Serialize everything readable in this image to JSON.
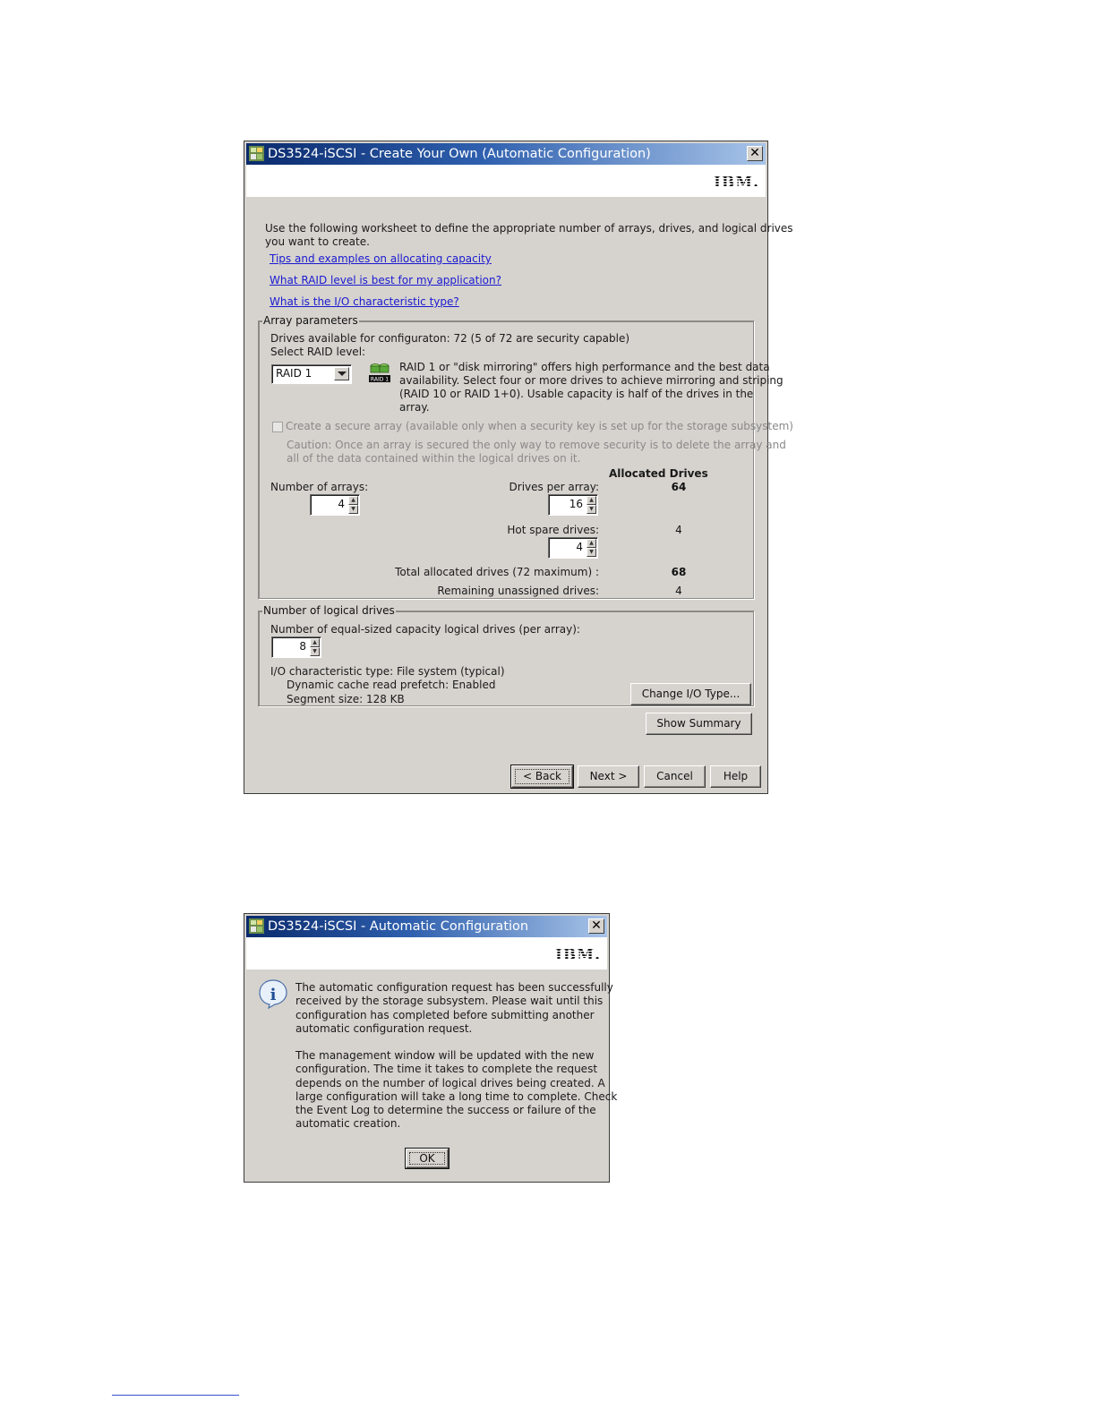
{
  "dialog1": {
    "title": "DS3524-iSCSI - Create Your Own (Automatic Configuration)",
    "close": "✕",
    "logo": "IBM.",
    "intro_line1": "Use the following worksheet to define the appropriate number of arrays, drives, and logical drives",
    "intro_line2": "you want to create.",
    "links": [
      "Tips and examples on allocating capacity",
      "What RAID level is best for my application?",
      "What is the I/O characteristic type?"
    ],
    "array_params": {
      "legend": "Array parameters",
      "drives_available": "Drives available for configuraton: 72 (5 of 72 are security capable)",
      "select_raid_label": "Select RAID level:",
      "raid_value": "RAID 1",
      "raid_icon_label": "RAID 1",
      "raid_desc": [
        "RAID 1 or \"disk mirroring\" offers high performance and the best data",
        "availability. Select four or more drives to achieve mirroring and striping",
        "(RAID 10 or RAID 1+0). Usable capacity is half of the drives in the",
        "array."
      ],
      "secure_label": "Create a secure array (available only when a security key is set up for the storage subsystem)",
      "caution": [
        "Caution: Once an array is secured the only way to remove security is to delete the array and",
        "all of the data contained within the logical drives on it."
      ],
      "allocated_header": "Allocated Drives",
      "num_arrays_label": "Number of arrays:",
      "num_arrays": "4",
      "drives_per_array_label": "Drives per array:",
      "drives_per_array": "16",
      "allocated_per_array": "64",
      "hot_spare_label": "Hot spare drives:",
      "hot_spare": "4",
      "allocated_hot_spare": "4",
      "total_label": "Total allocated drives (72 maximum) :",
      "total_value": "68",
      "remaining_label": "Remaining unassigned drives:",
      "remaining_value": "4"
    },
    "logical_drives": {
      "legend": "Number of logical drives",
      "equal_sized_label": "Number of equal-sized capacity logical drives (per array):",
      "count": "8",
      "io_type": "I/O characteristic type: File system (typical)",
      "prefetch": "Dynamic cache read prefetch: Enabled",
      "segment": "Segment size: 128  KB",
      "change_btn": "Change I/O Type..."
    },
    "show_summary": "Show Summary",
    "buttons": {
      "back": "< Back",
      "next": "Next >",
      "cancel": "Cancel",
      "help": "Help"
    }
  },
  "dialog2": {
    "title": "DS3524-iSCSI - Automatic Configuration",
    "close": "✕",
    "logo": "IBM.",
    "info_icon": "i",
    "para1": [
      "The automatic configuration request has been successfully",
      "received by the storage subsystem. Please wait until this",
      "configuration has completed before submitting another",
      "automatic configuration request."
    ],
    "para2": [
      "The management window will be updated with the new",
      "configuration. The time it takes to complete the request",
      "depends on the number of logical drives being created. A",
      "large configuration will take a long time to complete. Check",
      "the Event Log to determine the success or failure of the",
      "automatic creation."
    ],
    "ok": "OK"
  }
}
